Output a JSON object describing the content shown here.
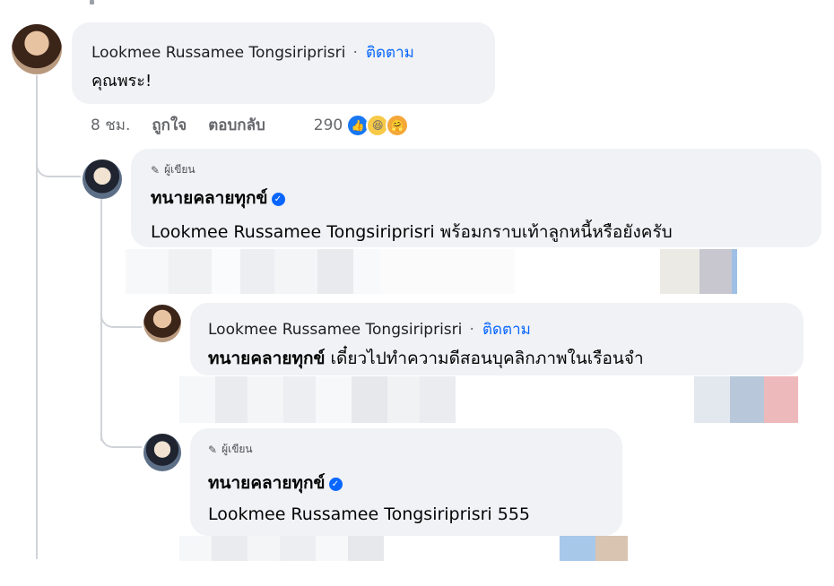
{
  "comments": [
    {
      "name": "Lookmee Russamee Tongsiriprisri",
      "follow": "ติดตาม",
      "separator": "·",
      "text": "คุณพระ!",
      "time": "8 ชม.",
      "like": "ถูกใจ",
      "reply": "ตอบกลับ",
      "reaction_count": "290",
      "reaction_icons": [
        "like-icon",
        "haha-icon",
        "care-icon"
      ]
    }
  ],
  "replies": [
    {
      "badge": "ผู้เขียน",
      "name": "ทนายคลายทุกข์",
      "mention": "Lookmee Russamee Tongsiriprisri",
      "text": "พร้อมกราบเท้าลูกหนี้หรือยังครับ",
      "verified": true
    },
    {
      "name": "Lookmee Russamee Tongsiriprisri",
      "separator": "·",
      "follow": "ติดตาม",
      "mention": "ทนายคลายทุกข์",
      "text": "เดี๋ยวไปทำความดีสอนบุคลิกภาพในเรือนจำ"
    },
    {
      "badge": "ผู้เขียน",
      "name": "ทนายคลายทุกข์",
      "mention": "Lookmee Russamee Tongsiriprisri",
      "text": "555",
      "verified": true
    }
  ],
  "colors": {
    "bubble": "#f0f2f5",
    "link": "#0866ff",
    "muted": "#65676b"
  }
}
